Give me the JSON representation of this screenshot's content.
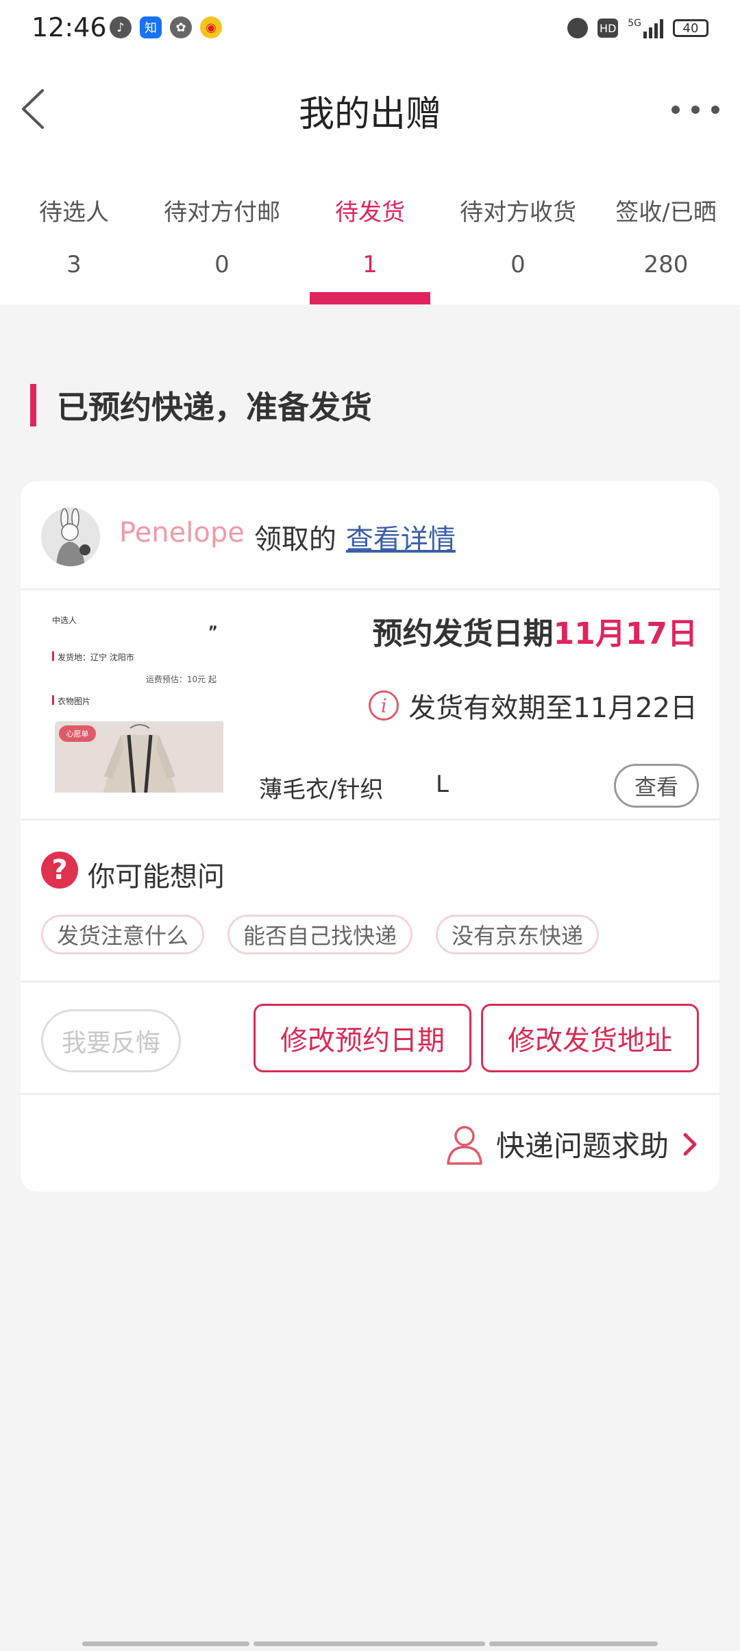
{
  "status_bar": {
    "time": "12:46",
    "left_icons": [
      "music-icon",
      "zhihu-icon",
      "fan-icon",
      "weibo-icon"
    ],
    "right_icons": [
      "alarm-icon",
      "hd-icon",
      "signal-5g-icon"
    ],
    "battery": "40"
  },
  "header": {
    "title": "我的出赠"
  },
  "tabs": [
    {
      "label": "待选人",
      "count": "3"
    },
    {
      "label": "待对方付邮",
      "count": "0"
    },
    {
      "label": "待发货",
      "count": "1"
    },
    {
      "label": "待对方收货",
      "count": "0"
    },
    {
      "label": "签收/已晒",
      "count": "280"
    }
  ],
  "section": {
    "heading": "已预约快递，准备发货"
  },
  "order": {
    "receiver_name": "Penelope",
    "receiver_verb": "领取的",
    "detail_link": "查看详情",
    "thumbnail": {
      "line1": "中选人",
      "line2": "发货地：辽宁 沈阳市",
      "line3": "运费预估：10元 起",
      "line4": "衣物图片",
      "badge": "心愿单"
    },
    "schedule_prefix": "预约发货日期",
    "schedule_date": "11月17日",
    "valid_until": "发货有效期至11月22日",
    "category": "薄毛衣/针织",
    "size": "L",
    "view_label": "查看"
  },
  "faq": {
    "title": "你可能想问",
    "chips": [
      "发货注意什么",
      "能否自己找快递",
      "没有京东快递"
    ]
  },
  "actions": {
    "regret": "我要反悔",
    "change_date": "修改预约日期",
    "change_address": "修改发货地址"
  },
  "help": {
    "label": "快递问题求助"
  },
  "colors": {
    "accent": "#e0245e",
    "link": "#3a5fa8",
    "receiver": "#f09aa6"
  }
}
